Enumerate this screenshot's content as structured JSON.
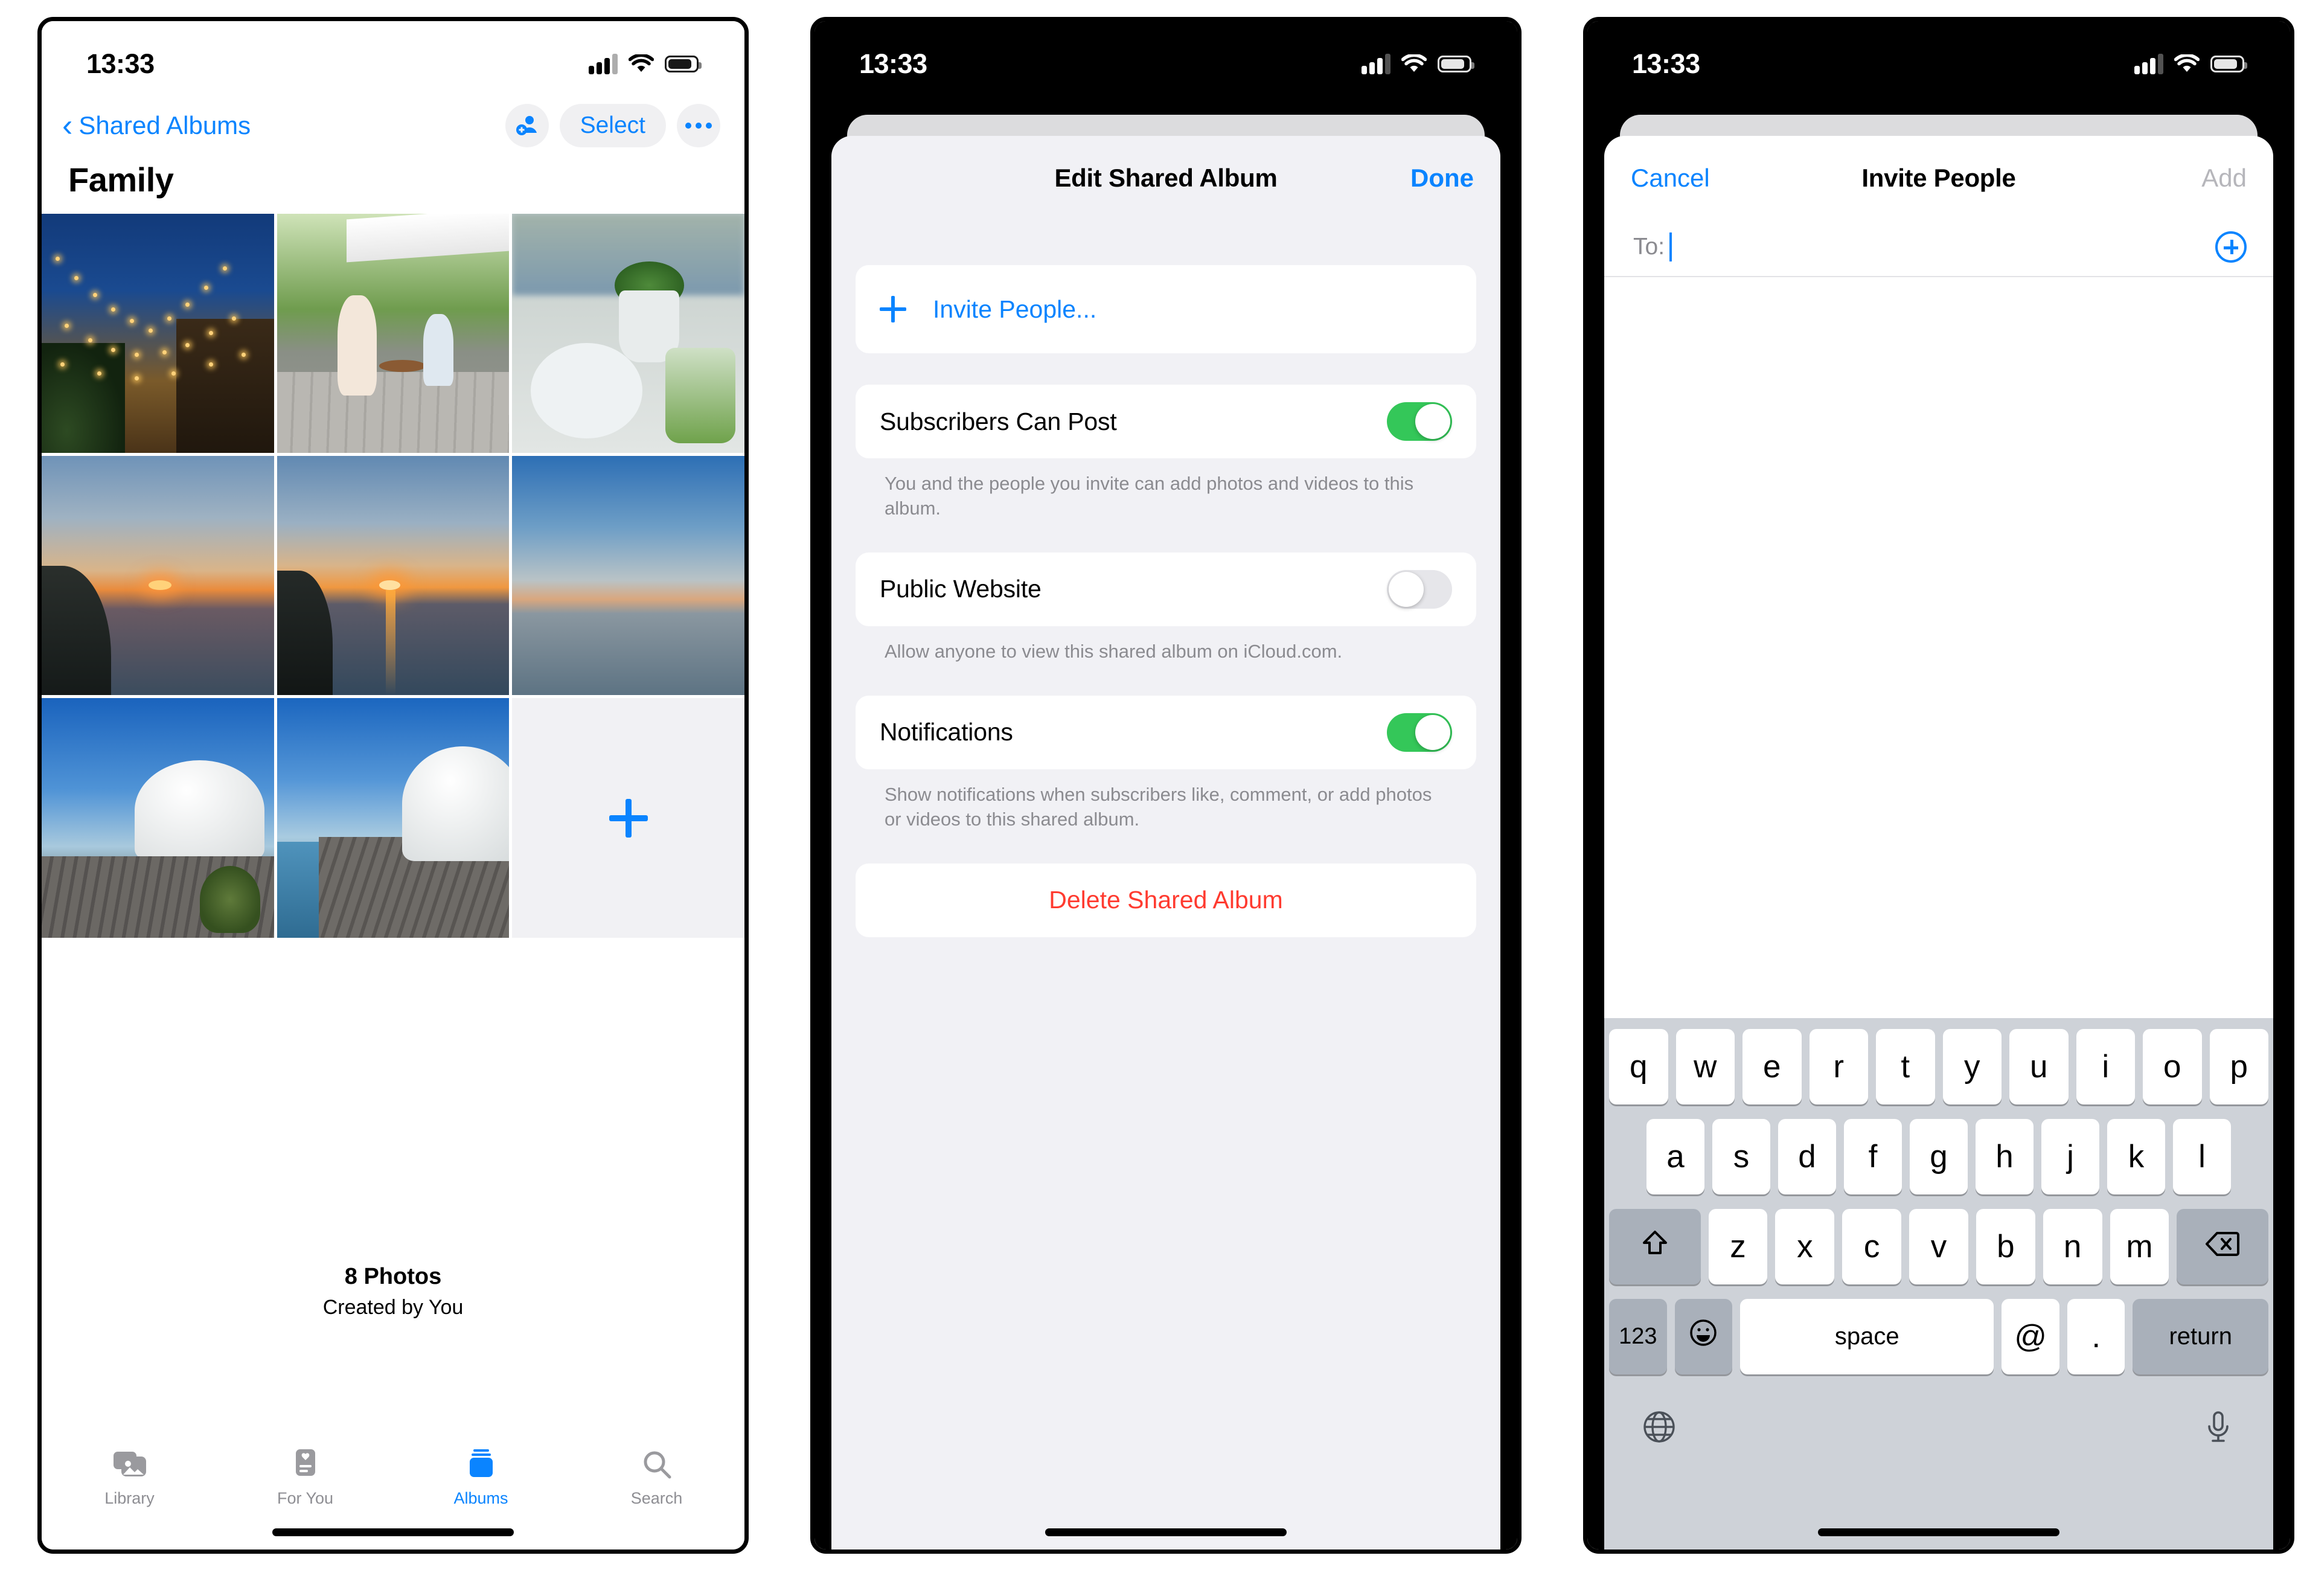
{
  "status_bar": {
    "time": "13:33",
    "icons": [
      "cellular-signal-icon",
      "wifi-icon",
      "battery-icon"
    ]
  },
  "phone1": {
    "nav": {
      "back_label": "Shared Albums",
      "back_icon": "chevron-left-icon",
      "add_people_icon": "person-badge-plus-icon",
      "select_label": "Select",
      "more_icon": "ellipsis-icon"
    },
    "album_title": "Family",
    "photos": [
      {
        "name": "string-lights-night",
        "scene": "ph-lights"
      },
      {
        "name": "cafe-mother-and-child",
        "scene": "ph-cafe"
      },
      {
        "name": "cafe-table-drink-plant",
        "scene": "ph-table"
      },
      {
        "name": "sea-sunset-left-cliff",
        "scene": "ph-sunset1"
      },
      {
        "name": "sea-sunset-reflection",
        "scene": "ph-sunset2"
      },
      {
        "name": "calm-sea-horizon",
        "scene": "ph-sunset3"
      },
      {
        "name": "dome-tent-deck",
        "scene": "ph-dome1"
      },
      {
        "name": "dome-tent-walkway",
        "scene": "ph-dome2"
      }
    ],
    "add_photo_icon": "plus-icon",
    "footer": {
      "count": "8 Photos",
      "creator": "Created by You"
    },
    "tabs": [
      {
        "label": "Library",
        "icon": "photo-stack-icon",
        "active": false
      },
      {
        "label": "For You",
        "icon": "memories-card-icon",
        "active": false
      },
      {
        "label": "Albums",
        "icon": "albums-book-icon",
        "active": true
      },
      {
        "label": "Search",
        "icon": "magnifier-icon",
        "active": false
      }
    ]
  },
  "phone2": {
    "sheet_title": "Edit Shared Album",
    "done_label": "Done",
    "invite": {
      "label": "Invite People...",
      "icon": "plus-icon"
    },
    "settings": [
      {
        "label": "Subscribers Can Post",
        "state": "on",
        "footnote": "You and the people you invite can add photos and videos to this album."
      },
      {
        "label": "Public Website",
        "state": "off",
        "footnote": "Allow anyone to view this shared album on iCloud.com."
      },
      {
        "label": "Notifications",
        "state": "on",
        "footnote": "Show notifications when subscribers like, comment, or add photos or videos to this shared album."
      }
    ],
    "delete_label": "Delete Shared Album",
    "colors": {
      "toggle_on": "#34c759",
      "destructive": "#ff3b30",
      "accent": "#0a84ff"
    }
  },
  "phone3": {
    "cancel_label": "Cancel",
    "sheet_title": "Invite People",
    "add_label": "Add",
    "to_field": {
      "label": "To:",
      "value": "",
      "add_contact_icon": "plus-circle-icon"
    },
    "keyboard": {
      "row1": [
        "q",
        "w",
        "e",
        "r",
        "t",
        "y",
        "u",
        "i",
        "o",
        "p"
      ],
      "row2": [
        "a",
        "s",
        "d",
        "f",
        "g",
        "h",
        "j",
        "k",
        "l"
      ],
      "row3": [
        "z",
        "x",
        "c",
        "v",
        "b",
        "n",
        "m"
      ],
      "shift_icon": "shift-arrow-icon",
      "backspace_icon": "delete-left-icon",
      "numbers_label": "123",
      "emoji_icon": "smiley-icon",
      "space_label": "space",
      "at_label": "@",
      "period_label": ".",
      "return_label": "return",
      "globe_icon": "globe-icon",
      "mic_icon": "microphone-icon"
    }
  }
}
